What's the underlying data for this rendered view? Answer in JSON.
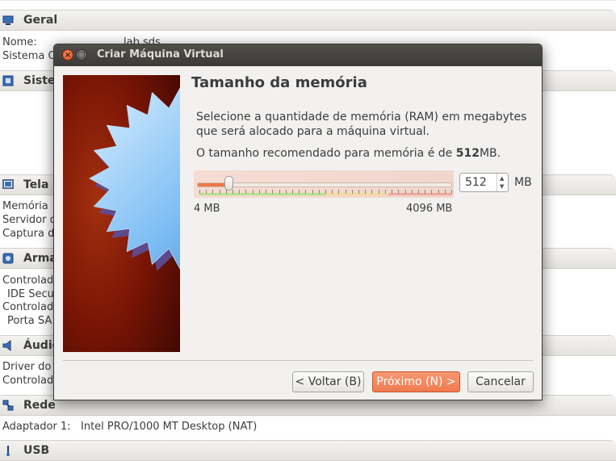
{
  "background": {
    "sections": [
      {
        "title": "Geral",
        "icon": "monitor-icon",
        "rows": [
          {
            "label": "Nome:",
            "value": "lab sds"
          },
          {
            "label": "Sistema O",
            "value": ""
          }
        ]
      },
      {
        "title": "Sistem",
        "icon": "chip-icon",
        "rows": []
      },
      {
        "title": "Tela",
        "icon": "display-icon",
        "rows": [
          {
            "label": "Memória",
            "value": ""
          },
          {
            "label": "Servidor d",
            "value": ""
          },
          {
            "label": "Captura d",
            "value": ""
          }
        ]
      },
      {
        "title": "Arma",
        "icon": "storage-icon",
        "rows": [
          {
            "label": "Controlado",
            "value": ""
          },
          {
            "label": "  IDE Secu",
            "value": ""
          },
          {
            "label": "Controlado",
            "value": ""
          },
          {
            "label": "  Porta SA",
            "value": ""
          }
        ]
      },
      {
        "title": "Áudio",
        "icon": "speaker-icon",
        "rows": [
          {
            "label": "Driver do",
            "value": ""
          },
          {
            "label": "Controlado",
            "value": ""
          }
        ]
      },
      {
        "title": "Rede",
        "icon": "network-icon",
        "rows": [
          {
            "label": "Adaptador 1:",
            "value": "Intel PRO/1000 MT Desktop (NAT)"
          }
        ]
      },
      {
        "title": "USB",
        "icon": "usb-icon",
        "rows": []
      }
    ]
  },
  "dialog": {
    "window_title": "Criar Máquina Virtual",
    "heading": "Tamanho da memória",
    "description": "Selecione a quantidade de memória (RAM) em megabytes que será alocado para a máquina virtual.",
    "recommended_prefix": "O tamanho recomendado para memória é de ",
    "recommended_value": "512",
    "recommended_suffix": "MB.",
    "memory": {
      "value": "512",
      "unit": "MB",
      "min_label": "4 MB",
      "max_label": "4096 MB",
      "min_mb": 4,
      "max_mb": 4096,
      "current_mb": 512,
      "green_until_mb": 2048,
      "yellow_until_mb": 3072
    },
    "buttons": {
      "back": "< Voltar (B)",
      "next": "Próximo (N) >",
      "cancel": "Cancelar"
    },
    "colors": {
      "accent": "#ef7a4f",
      "titlebar": "#3c3b37",
      "side_image_bg": "#7a1505",
      "star": "#7dbdf4"
    }
  }
}
